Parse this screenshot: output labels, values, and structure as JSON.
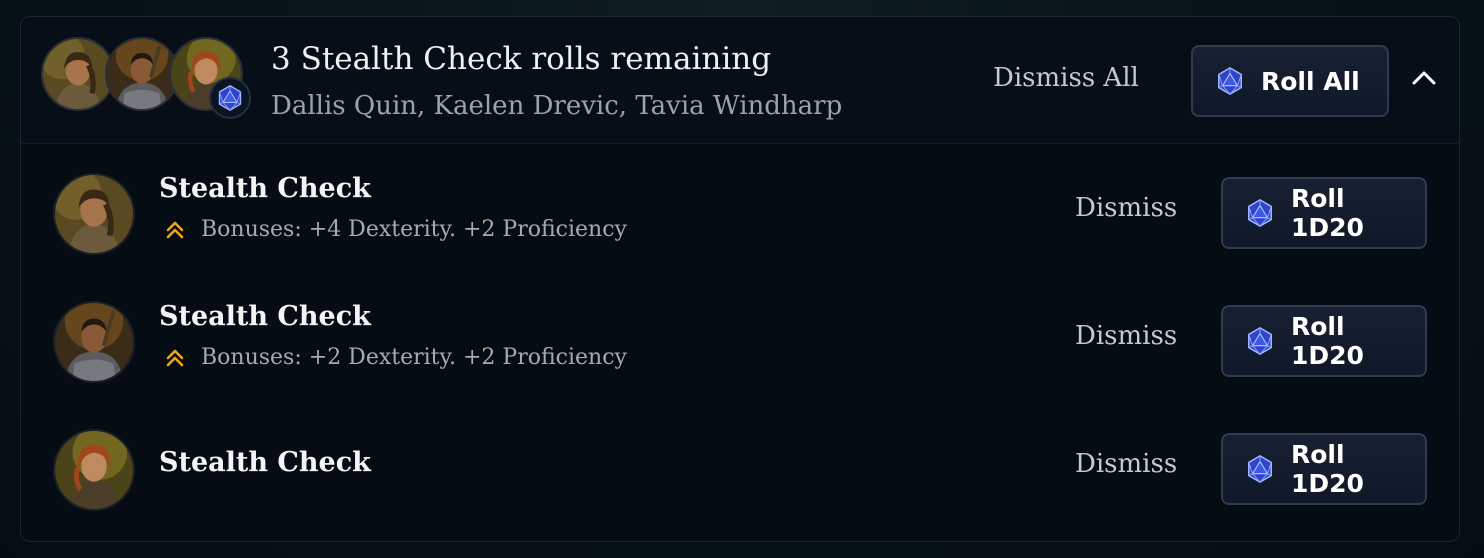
{
  "header": {
    "title": "3 Stealth Check rolls remaining",
    "characters": "Dallis Quin, Kaelen Drevic, Tavia Windharp",
    "dismiss_all_label": "Dismiss All",
    "roll_all_label": "Roll All",
    "collapse_icon": "chevron-up-icon",
    "die_icon": "d20-icon"
  },
  "rolls": [
    {
      "title": "Stealth Check",
      "bonus": "Bonuses: +4 Dexterity. +2 Proficiency",
      "dismiss_label": "Dismiss",
      "roll_label": "Roll 1D20"
    },
    {
      "title": "Stealth Check",
      "bonus": "Bonuses: +2 Dexterity. +2 Proficiency",
      "dismiss_label": "Dismiss",
      "roll_label": "Roll 1D20"
    },
    {
      "title": "Stealth Check",
      "dismiss_label": "Dismiss",
      "roll_label": "Roll 1D20"
    }
  ],
  "colors": {
    "background": "#050d12",
    "panel": "#060c14",
    "button": "#172133",
    "bonus_icon": "#f0a21e",
    "die": "#2f45c8"
  }
}
